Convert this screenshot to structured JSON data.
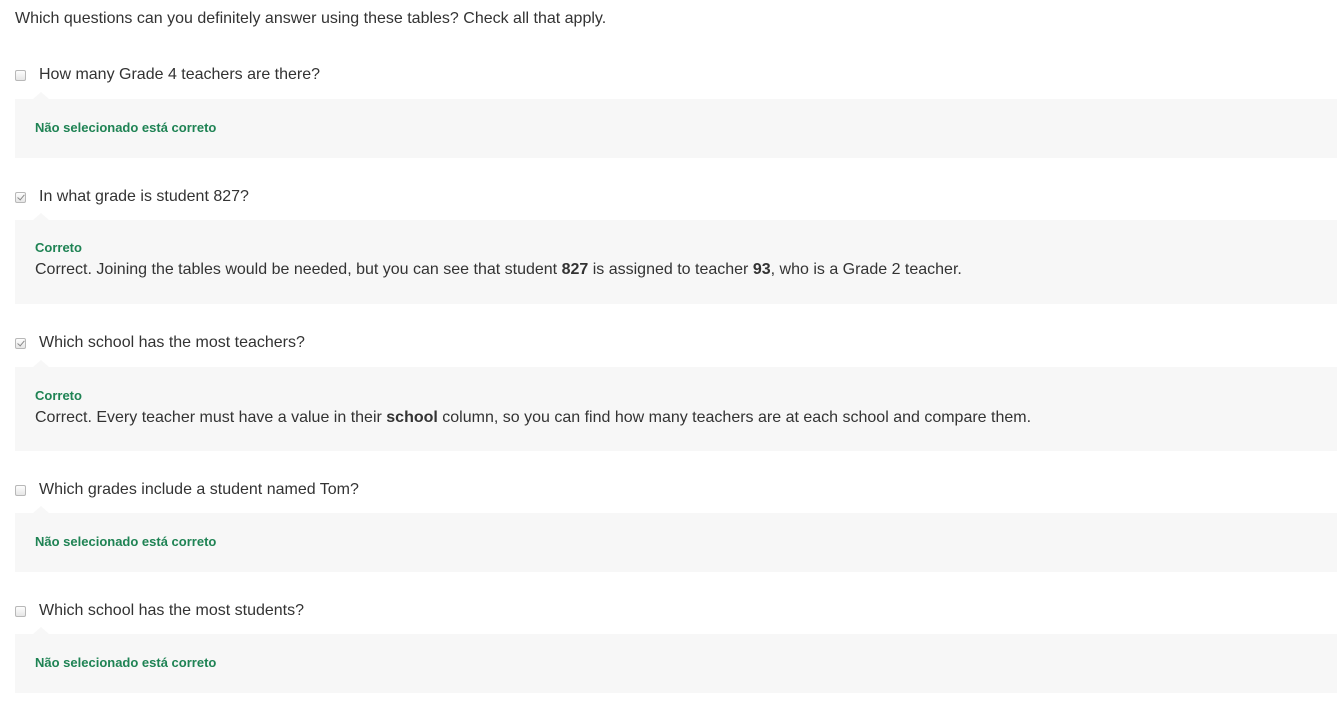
{
  "prompt": "Which questions can you definitely answer using these tables? Check all that apply.",
  "options": [
    {
      "text": "How many Grade 4 teachers are there?",
      "checked": false,
      "feedback_status": "Não selecionado está correto"
    },
    {
      "text": "In what grade is student 827?",
      "checked": true,
      "feedback_status": "Correto",
      "feedback_parts": [
        "Correct. Joining the tables would be needed, but you can see that student ",
        "827",
        " is assigned to teacher ",
        "93",
        ", who is a Grade 2 teacher."
      ]
    },
    {
      "text": "Which school has the most teachers?",
      "checked": true,
      "feedback_status": "Correto",
      "feedback_parts": [
        "Correct. Every teacher must have a value in their ",
        "school",
        " column, so you can find how many teachers are at each school and compare them."
      ]
    },
    {
      "text": "Which grades include a student named Tom?",
      "checked": false,
      "feedback_status": "Não selecionado está correto"
    },
    {
      "text": "Which school has the most students?",
      "checked": false,
      "feedback_status": "Não selecionado está correto"
    }
  ],
  "colors": {
    "status_green": "#1f8354",
    "feedback_bg": "#f7f7f7",
    "text": "#333333"
  }
}
